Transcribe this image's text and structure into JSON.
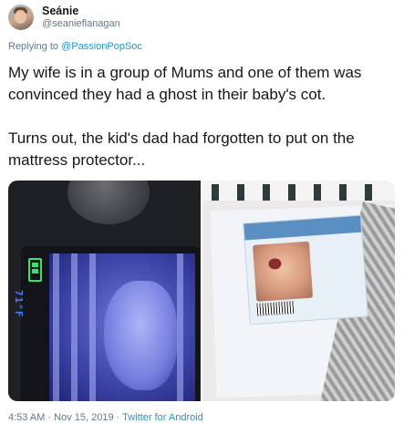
{
  "tweet": {
    "display_name": "Seánie",
    "handle": "@seanieflanagan",
    "reply_prefix": "Replying to ",
    "reply_to": "@PassionPopSoc",
    "text": "My wife is in a group of Mums and one of them was convinced they had a ghost in their baby's cot.\n\nTurns out, the kid's dad had forgotten to put on the mattress protector...",
    "timestamp": "4:53 AM · Nov 15, 2019 · ",
    "source": "Twitter for Android"
  },
  "media": {
    "monitor_screen_text": "71°F"
  },
  "colors": {
    "link": "#1b95e0",
    "muted": "#657786",
    "text": "#14171a"
  }
}
